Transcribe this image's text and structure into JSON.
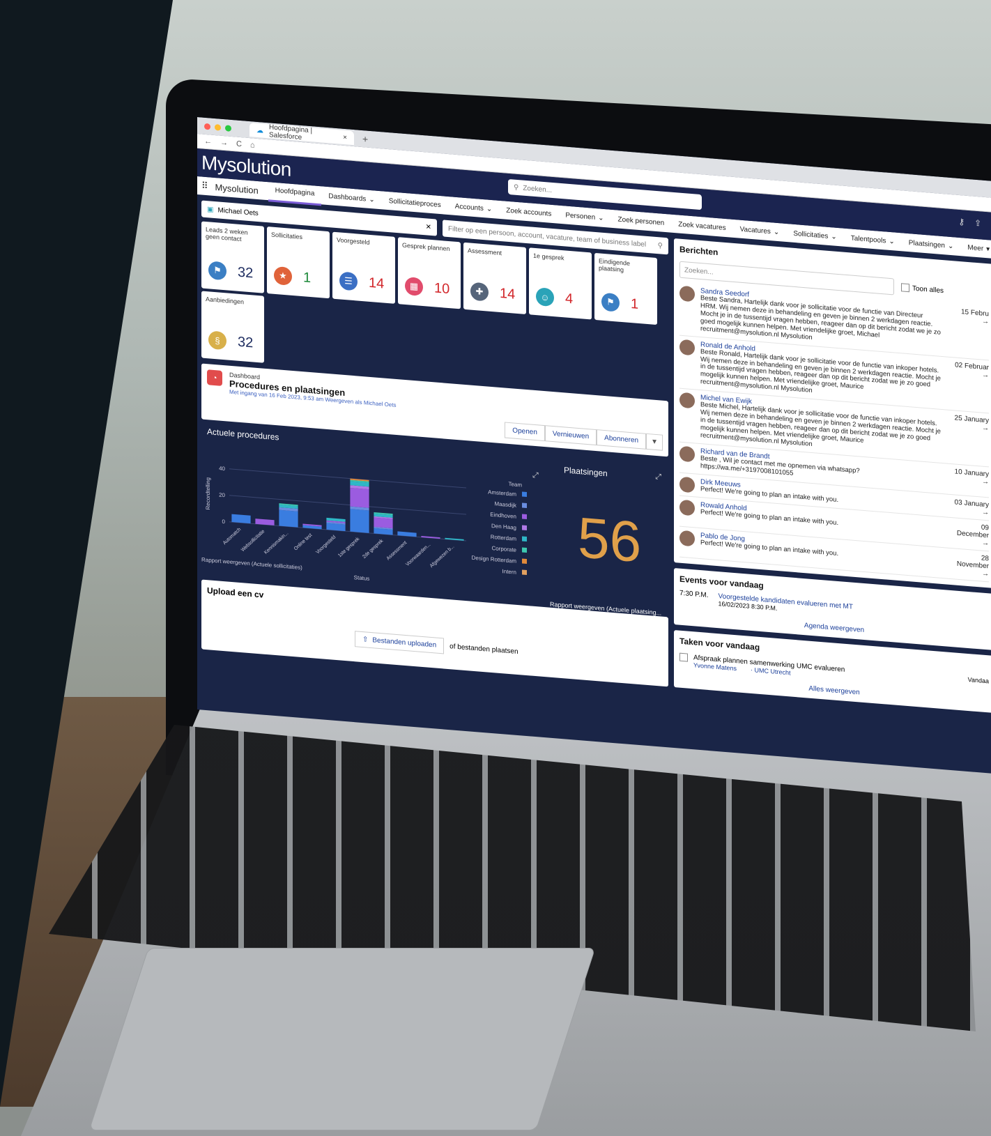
{
  "browser": {
    "tab_title": "Hoofdpagina | Salesforce",
    "tab_close": "×",
    "new_tab": "+",
    "nav_icons": [
      "←",
      "→",
      "C",
      "⌂"
    ]
  },
  "header": {
    "logo": "Mysolution",
    "search_placeholder": "Zoeken..."
  },
  "nav": {
    "app_name": "Mysolution",
    "items": [
      {
        "label": "Hoofdpagina",
        "dropdown": false,
        "active": true
      },
      {
        "label": "Dashboards",
        "dropdown": true
      },
      {
        "label": "Sollicitatieproces",
        "dropdown": false
      },
      {
        "label": "Accounts",
        "dropdown": true
      },
      {
        "label": "Zoek accounts",
        "dropdown": false
      },
      {
        "label": "Personen",
        "dropdown": true
      },
      {
        "label": "Zoek personen",
        "dropdown": false
      },
      {
        "label": "Zoek vacatures",
        "dropdown": false
      },
      {
        "label": "Vacatures",
        "dropdown": true
      },
      {
        "label": "Sollicitaties",
        "dropdown": true
      },
      {
        "label": "Talentpools",
        "dropdown": true
      },
      {
        "label": "Plaatsingen",
        "dropdown": true
      },
      {
        "label": "Meer",
        "dropdown": true
      }
    ]
  },
  "filter": {
    "recruiter": "Michael Oets",
    "placeholder": "Filter op een persoon, account, vacature, team of business label"
  },
  "tiles": [
    {
      "label": "Leads 2 weken geen contact",
      "value": "32",
      "color": "#3b7fc4",
      "value_color": "#1b2a5e"
    },
    {
      "label": "Sollicitaties",
      "value": "1",
      "color": "#e0633a",
      "value_color": "#1f8a3b"
    },
    {
      "label": "Voorgesteld",
      "value": "14",
      "color": "#3b6fc4",
      "value_color": "#d2272b"
    },
    {
      "label": "Gesprek plannen",
      "value": "10",
      "color": "#e14c6c",
      "value_color": "#d2272b"
    },
    {
      "label": "Assessment",
      "value": "14",
      "color": "#56657a",
      "value_color": "#d2272b"
    },
    {
      "label": "1e gesprek",
      "value": "4",
      "color": "#2aa3b8",
      "value_color": "#d2272b"
    },
    {
      "label": "Eindigende plaatsing",
      "value": "1",
      "color": "#3b7fc4",
      "value_color": "#d2272b"
    },
    {
      "label": "Aanbiedingen",
      "value": "32",
      "color": "#d8b04a",
      "value_color": "#1b2a5e"
    }
  ],
  "dashboard": {
    "type": "Dashboard",
    "title": "Procedures en plaatsingen",
    "subtitle": "Met ingang van 16 Feb 2023, 9:53 am Weergeven als Michael Oets",
    "buttons": [
      "Openen",
      "Vernieuwen",
      "Abonneren"
    ],
    "caret": "▼"
  },
  "chart_data": {
    "type": "bar",
    "title": "Actuele procedures",
    "ylabel": "Recordtelling",
    "xlabel": "Status",
    "ylim": [
      0,
      40
    ],
    "yticks": [
      0,
      20,
      40
    ],
    "categories": [
      "Automatch",
      "Websollicitatie",
      "Kennismakin...",
      "Online test",
      "Voorgesteld",
      "1ste gesprek",
      "2de gesprek",
      "Assessment",
      "Voorwaarden...",
      "Afgewezen b..."
    ],
    "series": [
      {
        "name": "Amsterdam",
        "color": "#3a7de0",
        "values": [
          6,
          0,
          12,
          2,
          5,
          17,
          4,
          3,
          0,
          0
        ]
      },
      {
        "name": "Maasdijk",
        "color": "#6a8de0",
        "values": [
          0,
          0,
          2,
          0,
          1,
          2,
          1,
          0,
          0,
          0
        ]
      },
      {
        "name": "Eindhoven",
        "color": "#9b5ce0",
        "values": [
          0,
          4,
          0,
          1,
          1,
          14,
          7,
          0,
          1,
          0
        ]
      },
      {
        "name": "Den Haag",
        "color": "#b07ae6",
        "values": [
          0,
          0,
          0,
          0,
          0,
          2,
          1,
          0,
          0,
          0
        ]
      },
      {
        "name": "Rotterdam",
        "color": "#2fb7c7",
        "values": [
          0,
          0,
          2,
          0,
          2,
          3,
          2,
          0,
          0,
          1
        ]
      },
      {
        "name": "Corporate",
        "color": "#3ec8b0",
        "values": [
          0,
          0,
          1,
          0,
          0,
          1,
          1,
          0,
          0,
          0
        ]
      },
      {
        "name": "Design Rotterdam",
        "color": "#e28a3a",
        "values": [
          0,
          0,
          0,
          0,
          0,
          1,
          0,
          0,
          0,
          0
        ]
      },
      {
        "name": "Intern",
        "color": "#e2a060",
        "values": [
          0,
          0,
          0,
          0,
          0,
          0,
          0,
          0,
          0,
          0
        ]
      }
    ],
    "legend_title": "Team",
    "legend_position": "right",
    "report_link": "Rapport weergeven (Actuele sollicitaties)"
  },
  "kpi": {
    "title": "Plaatsingen",
    "value": "56",
    "report_link": "Rapport weergeven (Actuele plaatsing..."
  },
  "upload": {
    "title": "Upload een cv",
    "button": "Bestanden uploaden",
    "or_text": "of bestanden plaatsen"
  },
  "messages": {
    "title": "Berichten",
    "search_placeholder": "Zoeken...",
    "toggle": "Toon alles",
    "items": [
      {
        "name": "Sandra Seedorf",
        "text": "Beste Sandra, Hartelijk dank voor je sollicitatie voor de functie van Directeur HRM. Wij nemen deze in behandeling en geven je binnen 2 werkdagen reactie. Mocht je in de tussentijd vragen hebben, reageer dan op dit bericht zodat we je zo goed mogelijk kunnen helpen. Met vriendelijke groet, Michael recruitment@mysolution.nl Mysolution",
        "date": "15 Febru"
      },
      {
        "name": "Ronald de Anhold",
        "text": "Beste Ronald, Hartelijk dank voor je sollicitatie voor de functie van inkoper hotels. Wij nemen deze in behandeling en geven je binnen 2 werkdagen reactie. Mocht je in de tussentijd vragen hebben, reageer dan op dit bericht zodat we je zo goed mogelijk kunnen helpen. Met vriendelijke groet, Maurice recruitment@mysolution.nl Mysolution",
        "date": "02 Februar"
      },
      {
        "name": "Michel van Ewijk",
        "text": "Beste Michel, Hartelijk dank voor je sollicitatie voor de functie van inkoper hotels. Wij nemen deze in behandeling en geven je binnen 2 werkdagen reactie. Mocht je in de tussentijd vragen hebben, reageer dan op dit bericht zodat we je zo goed mogelijk kunnen helpen. Met vriendelijke groet, Maurice recruitment@mysolution.nl Mysolution",
        "date": "25 January"
      },
      {
        "name": "Richard van de Brandt",
        "text": "Beste , Wil je contact met me opnemen via whatsapp? https://wa.me/+3197008101055",
        "date": "10 January"
      },
      {
        "name": "Dirk Meeuws",
        "text": "Perfect! We're going to plan an intake with you.",
        "date": "03 January"
      },
      {
        "name": "Rowald Anhold",
        "text": "Perfect! We're going to plan an intake with you.",
        "date": "09 December"
      },
      {
        "name": "Pablo de Jong",
        "text": "Perfect! We're going to plan an intake with you.",
        "date": "28 November"
      }
    ]
  },
  "events": {
    "title": "Events voor vandaag",
    "time": "7:30 P.M.",
    "event_title": "Voorgestelde kandidaten evalueren met MT",
    "event_date": "16/02/2023 8:30 P.M.",
    "link": "Agenda weergeven"
  },
  "tasks": {
    "title": "Taken voor vandaag",
    "task": "Afspraak plannen samenwerking UMC evalueren",
    "person": "Yvonne Matens",
    "account": "· UMC Utrecht",
    "due": "Vandaa",
    "link": "Alles weergeven"
  }
}
